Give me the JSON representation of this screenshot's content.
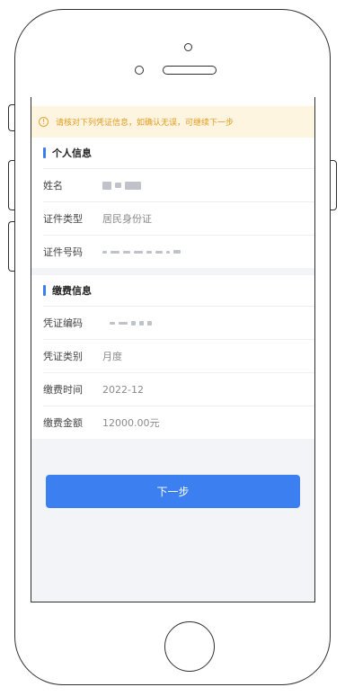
{
  "notice": {
    "icon": "alert-circle-icon",
    "text": "请核对下列凭证信息，如确认无误，可继续下一步"
  },
  "personal": {
    "title": "个人信息",
    "rows": [
      {
        "label": "姓名",
        "value": ""
      },
      {
        "label": "证件类型",
        "value": "居民身份证"
      },
      {
        "label": "证件号码",
        "value": ""
      }
    ]
  },
  "payment": {
    "title": "缴费信息",
    "rows": [
      {
        "label": "凭证编码",
        "value": ""
      },
      {
        "label": "凭证类别",
        "value": "月度"
      },
      {
        "label": "缴费时间",
        "value": "2022-12"
      },
      {
        "label": "缴费金额",
        "value": "12000.00元"
      }
    ]
  },
  "actions": {
    "next_label": "下一步"
  },
  "colors": {
    "accent": "#3b7ff0",
    "notice_bg": "#fdf5df",
    "notice_text": "#e09b22"
  }
}
